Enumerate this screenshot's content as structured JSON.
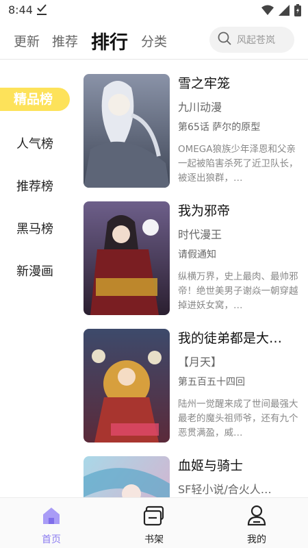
{
  "status": {
    "time": "8:44"
  },
  "nav": {
    "tabs": [
      "更新",
      "推荐",
      "排行",
      "分类"
    ],
    "active_tab": "排行",
    "search_placeholder": "风起苍岚"
  },
  "sidebar": {
    "items": [
      "精品榜",
      "人气榜",
      "推荐榜",
      "黑马榜",
      "新漫画"
    ],
    "active": "精品榜"
  },
  "comics": [
    {
      "title": "雪之牢笼",
      "author": "九川动漫",
      "chapter": "第65话 萨尔的原型",
      "desc": "OMEGA狼族少年泽恩和父亲一起被陷害杀死了近卫队长，被逐出狼群，…"
    },
    {
      "title": "我为邪帝",
      "author": "时代漫王",
      "chapter": "请假通知",
      "desc": "纵横万界，史上最肉、最帅邪帝！绝世美男子谢焱一朝穿越掉进妖女窝，…"
    },
    {
      "title": "我的徒弟都是大…",
      "author": "【月天】",
      "chapter": "第五百五十四回",
      "desc": "陆州一觉醒来成了世间最强大最老的魔头祖师爷，还有九个恶贯满盈，威…"
    },
    {
      "title": "血姬与骑士",
      "author": "SF轻小说/合火人…",
      "chapter": "",
      "desc": ""
    }
  ],
  "bottom_nav": {
    "items": [
      "首页",
      "书架",
      "我的"
    ],
    "active": "首页"
  },
  "colors": {
    "accent_yellow": "#fde25a",
    "accent_purple": "#8b7cf0"
  }
}
